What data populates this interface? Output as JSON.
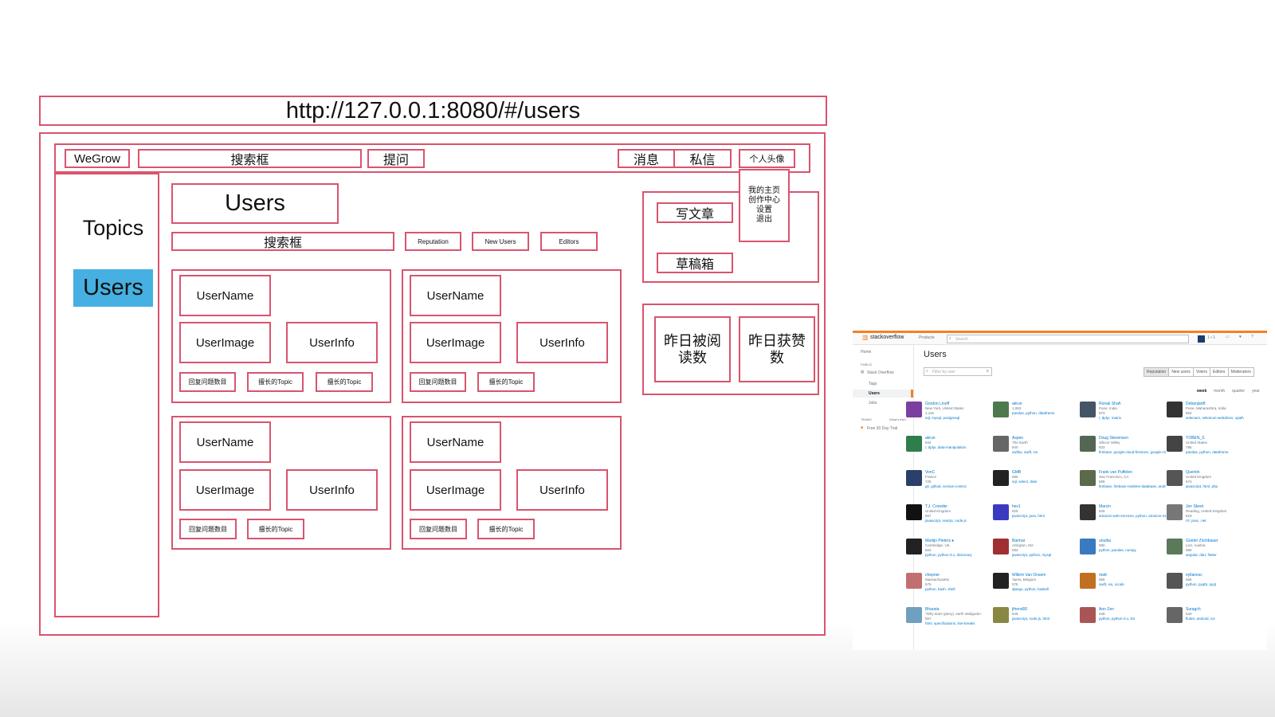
{
  "url_bar": "http://127.0.0.1:8080/#/users",
  "header": {
    "logo": "WeGrow",
    "search": "搜索框",
    "ask": "提问",
    "messages": "消息",
    "dm": "私信",
    "avatar": "个人头像"
  },
  "avatar_menu": [
    "我的主页",
    "创作中心",
    "设置",
    "退出"
  ],
  "sidebar": {
    "topics": "Topics",
    "users": "Users"
  },
  "main": {
    "title": "Users",
    "search": "搜索框",
    "tabs": [
      "Reputation",
      "New Users",
      "Editors"
    ]
  },
  "user_card": {
    "name": "UserName",
    "image": "UserImage",
    "info": "UserInfo",
    "answers": "回复问题数目",
    "topic": "擅长的Topic"
  },
  "writer": {
    "write": "写文章",
    "drafts": "草稿箱"
  },
  "stats": {
    "views": "昨日被阅读数",
    "likes": "昨日获赞数"
  },
  "so": {
    "brand": "stackoverflow",
    "products": "Products",
    "search_placeholder": "Search",
    "rep": "1 • 1",
    "nav": [
      "Home",
      "PUBLIC",
      "Stack Overflow",
      "Tags",
      "Users",
      "Jobs",
      "TEAMS",
      "What's this?",
      "Free 30 Day Trial"
    ],
    "title": "Users",
    "filter_placeholder": "Filter by user",
    "tabs": [
      "Reputation",
      "New users",
      "Voters",
      "Editors",
      "Moderators"
    ],
    "periods": [
      "week",
      "month",
      "quarter",
      "year"
    ],
    "users": [
      {
        "name": "Gordon Linoff",
        "loc": "New York, United States",
        "rep": "1,115",
        "tags": "sql, mysql, postgresql",
        "color": "#7b3fa0"
      },
      {
        "name": "akrun",
        "loc": "",
        "rep": "1,063",
        "tags": "pandas, python, dataframe",
        "color": "#4c7a4c"
      },
      {
        "name": "Ronak Shah",
        "loc": "Pune, India",
        "rep": "973",
        "tags": "r, dplyr, matrix",
        "color": "#445566"
      },
      {
        "name": "DebanjanB",
        "loc": "Pune, Maharashtra, India",
        "rep": "954",
        "tags": "selenium, selenium-webdriver, xpath",
        "color": "#333333"
      },
      {
        "name": "akrun",
        "loc": "",
        "rep": "944",
        "tags": "r, dplyr, data-manipulation",
        "color": "#2f7d4a"
      },
      {
        "name": "Aspen",
        "loc": "The Earth",
        "rep": "840",
        "tags": "swiftui, swift, ios",
        "color": "#666666"
      },
      {
        "name": "Doug Stevenson",
        "loc": "Silicon Valley",
        "rep": "833",
        "tags": "firebase, google-cloud-firestore, google-cloud-functions",
        "color": "#556655"
      },
      {
        "name": "YOBEN_S",
        "loc": "United States",
        "rep": "795",
        "tags": "pandas, python, dataframe",
        "color": "#444444"
      },
      {
        "name": "VonC",
        "loc": "France",
        "rep": "725",
        "tags": "git, github, version-control",
        "color": "#2a3f6a"
      },
      {
        "name": "GMB",
        "loc": "",
        "rep": "695",
        "tags": "sql, select, date",
        "color": "#222222"
      },
      {
        "name": "Frank van Puffelen",
        "loc": "San Francisco, CA",
        "rep": "685",
        "tags": "firebase, firebase-realtime-database, android",
        "color": "#5a6a4a"
      },
      {
        "name": "Quentin",
        "loc": "United Kingdom",
        "rep": "674",
        "tags": "javascript, html, php",
        "color": "#555555"
      },
      {
        "name": "T.J. Crowder",
        "loc": "United Kingdom",
        "rep": "667",
        "tags": "javascript, reactjs, node.js",
        "color": "#111111"
      },
      {
        "name": "hev1",
        "loc": "",
        "rep": "626",
        "tags": "javascript, java, html",
        "color": "#3a3ac0"
      },
      {
        "name": "Marcin",
        "loc": "",
        "rep": "626",
        "tags": "amazon-web-services, python, amazon-s3",
        "color": "#333333"
      },
      {
        "name": "Jon Skeet",
        "loc": "Reading, United Kingdom",
        "rep": "619",
        "tags": "c#, java, .net",
        "color": "#777777"
      },
      {
        "name": "Martijn Pieters ♦",
        "loc": "Cambridge, UK",
        "rep": "603",
        "tags": "python, python-3.x, dictionary",
        "color": "#222222"
      },
      {
        "name": "Barmar",
        "loc": "Arlington, MA",
        "rep": "593",
        "tags": "javascript, python, mysql",
        "color": "#a03030"
      },
      {
        "name": "unutbu",
        "loc": "",
        "rep": "590",
        "tags": "python, pandas, numpy",
        "color": "#3a7ac0"
      },
      {
        "name": "Günter Zöchbauer",
        "loc": "Linz, Austria",
        "rep": "590",
        "tags": "angular, dart, flutter",
        "color": "#5a7a5a"
      },
      {
        "name": "chepner",
        "loc": "Massachusetts",
        "rep": "579",
        "tags": "python, bash, shell",
        "color": "#c07070"
      },
      {
        "name": "Willem Van Onsem",
        "loc": "Ypres, Belgium",
        "rep": "578",
        "tags": "django, python, haskell",
        "color": "#222222"
      },
      {
        "name": "matt",
        "loc": "",
        "rep": "565",
        "tags": "swift, ios, xcode",
        "color": "#c07020"
      },
      {
        "name": "eyllanesc",
        "loc": "",
        "rep": "565",
        "tags": "python, pyqt5, pyqt",
        "color": "#555555"
      },
      {
        "name": "Bharata",
        "loc": "\"Why does (ptery), earth sMdgods»",
        "rep": "557",
        "tags": "html, specifications, line-breaks",
        "color": "#70a0c0"
      },
      {
        "name": "jfriend00",
        "loc": "",
        "rep": "549",
        "tags": "javascript, node.js, html",
        "color": "#888844"
      },
      {
        "name": "Ann Zen",
        "loc": "",
        "rep": "548",
        "tags": "python, python-3.x, list",
        "color": "#aa5555"
      },
      {
        "name": "Suragch",
        "loc": "",
        "rep": "540",
        "tags": "flutter, android, ios",
        "color": "#666666"
      }
    ]
  }
}
